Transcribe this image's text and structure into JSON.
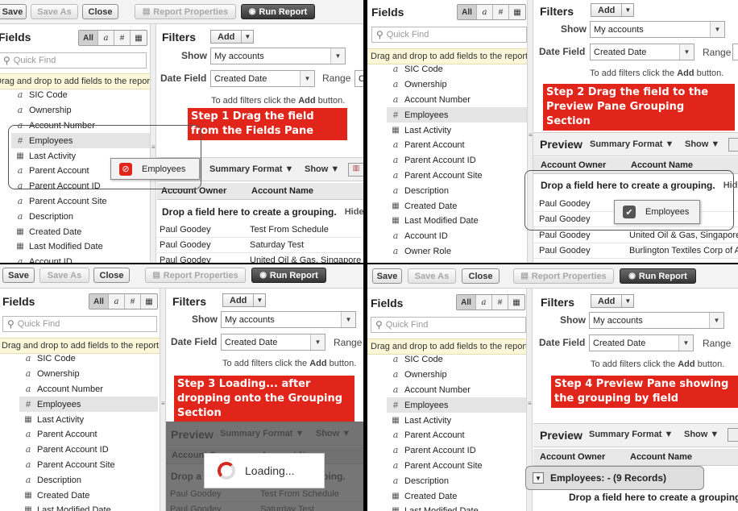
{
  "toolbar": {
    "save": "Save",
    "save_as": "Save As",
    "close": "Close",
    "report_properties": "Report Properties",
    "run_report": "Run Report"
  },
  "fields_pane": {
    "title": "Fields",
    "filter_buttons": [
      "All",
      "a",
      "#",
      "cal"
    ],
    "quick_find_placeholder": "Quick Find",
    "drag_note": "Drag and drop to add fields to the report."
  },
  "field_list": [
    {
      "label": "SIC Code",
      "icon": "text"
    },
    {
      "label": "Ownership",
      "icon": "text"
    },
    {
      "label": "Account Number",
      "icon": "text"
    },
    {
      "label": "Employees",
      "icon": "number"
    },
    {
      "label": "Last Activity",
      "icon": "calendar"
    },
    {
      "label": "Parent Account",
      "icon": "text"
    },
    {
      "label": "Parent Account ID",
      "icon": "text"
    },
    {
      "label": "Parent Account Site",
      "icon": "text"
    },
    {
      "label": "Description",
      "icon": "text"
    },
    {
      "label": "Created Date",
      "icon": "calendar"
    },
    {
      "label": "Last Modified Date",
      "icon": "calendar"
    },
    {
      "label": "Account ID",
      "icon": "text"
    },
    {
      "label": "Owner Role",
      "icon": "text"
    }
  ],
  "filters": {
    "title": "Filters",
    "add": "Add",
    "show_label": "Show",
    "show_value": "My accounts",
    "date_field_label": "Date Field",
    "date_field_value": "Created Date",
    "range_label": "Range",
    "range_value_fragment": "C",
    "hint_prefix": "To add filters click the ",
    "hint_bold": "Add",
    "hint_suffix": " button."
  },
  "preview": {
    "title": "Preview",
    "summary_format": "Summary Format",
    "show": "Show",
    "col_owner": "Account Owner",
    "col_name": "Account Name",
    "drop_text": "Drop a field here to create a grouping.",
    "hide": "Hide",
    "hide_fragment": "Hid",
    "rows": [
      {
        "owner": "Paul Goodey",
        "name": "Test From Schedule"
      },
      {
        "owner": "Paul Goodey",
        "name": "Saturday Test"
      },
      {
        "owner": "Paul Goodey",
        "name": "United Oil & Gas, Singapore"
      },
      {
        "owner": "Paul Goodey",
        "name": "Burlington Textiles Corp of America"
      }
    ],
    "row3_fragment": "United Oil & Gas, Singapore"
  },
  "drag_ghost": {
    "label": "Employees"
  },
  "loading": {
    "text": "Loading..."
  },
  "grouping": {
    "text": "Employees: - (9 Records)"
  },
  "steps": {
    "step1": "Step 1 Drag the field from the Fields Pane",
    "step2": "Step 2 Drag the field to the Preview Pane Grouping Section",
    "step3": "Step 3 Loading... after dropping onto the Grouping Section",
    "step4": "Step 4 Preview Pane showing the grouping by field"
  },
  "colors": {
    "step_banner": "#e1251b",
    "note_bg": "#fcf7d9",
    "run_button": "#353535"
  }
}
